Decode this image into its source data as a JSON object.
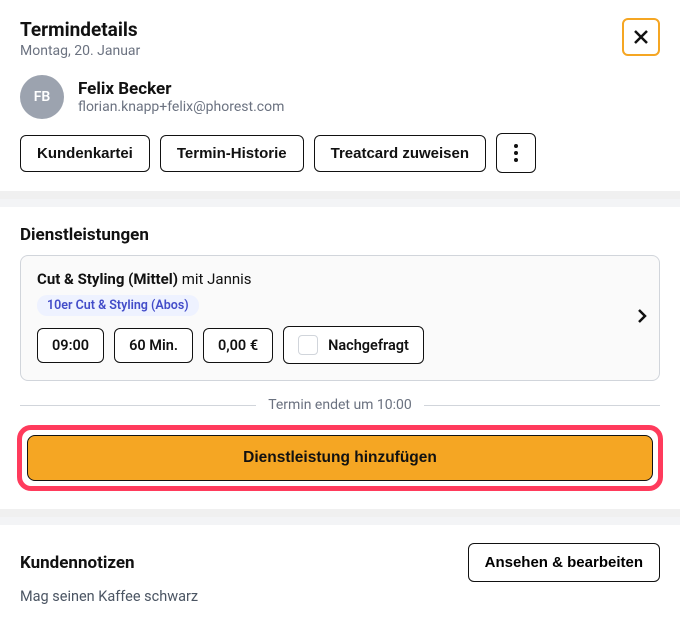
{
  "header": {
    "title": "Termindetails",
    "date": "Montag, 20. Januar"
  },
  "client": {
    "initials": "FB",
    "name": "Felix Becker",
    "email": "florian.knapp+felix@phorest.com"
  },
  "actions": {
    "card": "Kundenkartei",
    "history": "Termin-Historie",
    "treatcard": "Treatcard zuweisen"
  },
  "services": {
    "heading": "Dienstleistungen",
    "item": {
      "name": "Cut & Styling (Mittel)",
      "with_label": "mit Jannis",
      "subscription": "10er Cut & Styling (Abos)",
      "time": "09:00",
      "duration": "60 Min.",
      "price": "0,00 €",
      "status": "Nachgefragt"
    },
    "ends_at": "Termin endet um 10:00",
    "add_label": "Dienstleistung hinzufügen"
  },
  "notes": {
    "heading": "Kundennotizen",
    "view_edit": "Ansehen & bearbeiten",
    "text": "Mag seinen Kaffee schwarz"
  }
}
